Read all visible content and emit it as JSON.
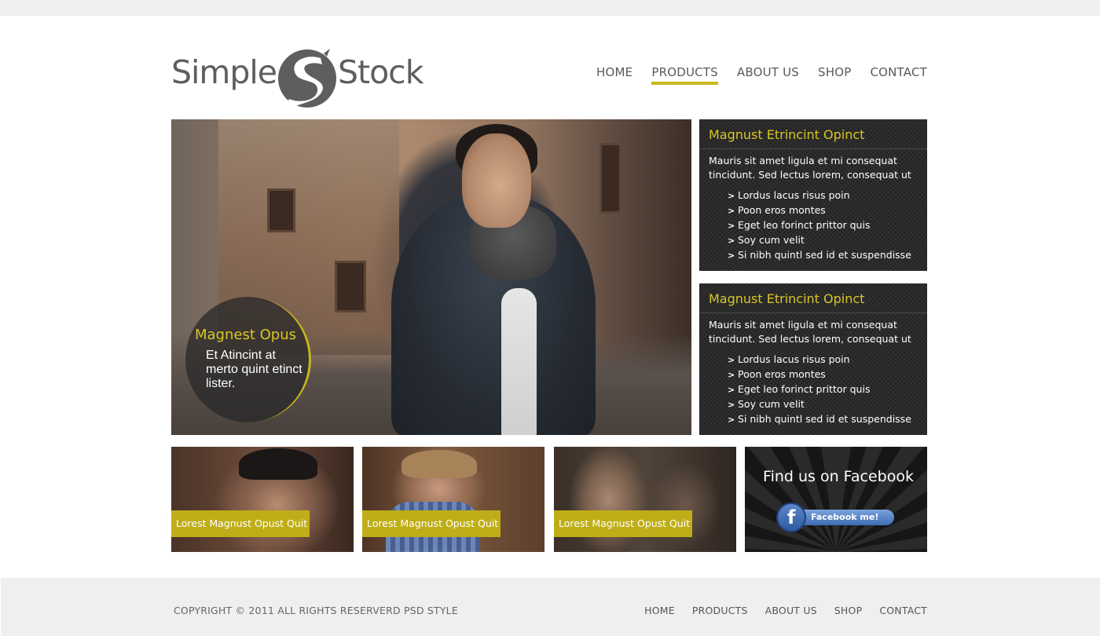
{
  "brand": {
    "left_word": "Simple",
    "right_word": "Stock",
    "accent": "#c9b81c"
  },
  "nav": [
    {
      "label": "HOME",
      "active": false
    },
    {
      "label": "PRODUCTS",
      "active": true
    },
    {
      "label": "ABOUT US",
      "active": false
    },
    {
      "label": "SHOP",
      "active": false
    },
    {
      "label": "CONTACT",
      "active": false
    }
  ],
  "hero": {
    "caption_title": "Magnest Opus",
    "caption_text": "Et Atincint at merto quint etinct lister."
  },
  "side_boxes": [
    {
      "title": "Magnust Etrincint Opinct",
      "text": "Mauris sit amet ligula et mi consequat tincidunt. Sed lectus lorem, consequat ut",
      "items": [
        "Lordus lacus risus poin",
        "Poon eros montes",
        "Eget leo forinct prittor quis",
        "Soy cum velit",
        "Si nibh quintl sed id et suspendisse"
      ]
    },
    {
      "title": "Magnust Etrincint Opinct",
      "text": "Mauris sit amet ligula et mi consequat tincidunt. Sed lectus lorem, consequat ut",
      "items": [
        "Lordus lacus risus poin",
        "Poon eros montes",
        "Eget leo forinct prittor quis",
        "Soy cum velit",
        "Si nibh quintl sed id et suspendisse"
      ]
    }
  ],
  "thumbs": [
    {
      "label": "Lorest Magnust Opust Quit"
    },
    {
      "label": "Lorest Magnust Opust Quit"
    },
    {
      "label": "Lorest Magnust Opust Quit"
    }
  ],
  "facebook": {
    "title": "Find us on Facebook",
    "button_label": "Facebook me!",
    "icon_letter": "f",
    "icon": "facebook-icon"
  },
  "footer": {
    "copyright": "COPYRIGHT © 2011 ALL RIGHTS RESERVERD PSD STYLE",
    "nav": [
      "HOME",
      "PRODUCTS",
      "ABOUT US",
      "SHOP",
      "CONTACT"
    ]
  }
}
